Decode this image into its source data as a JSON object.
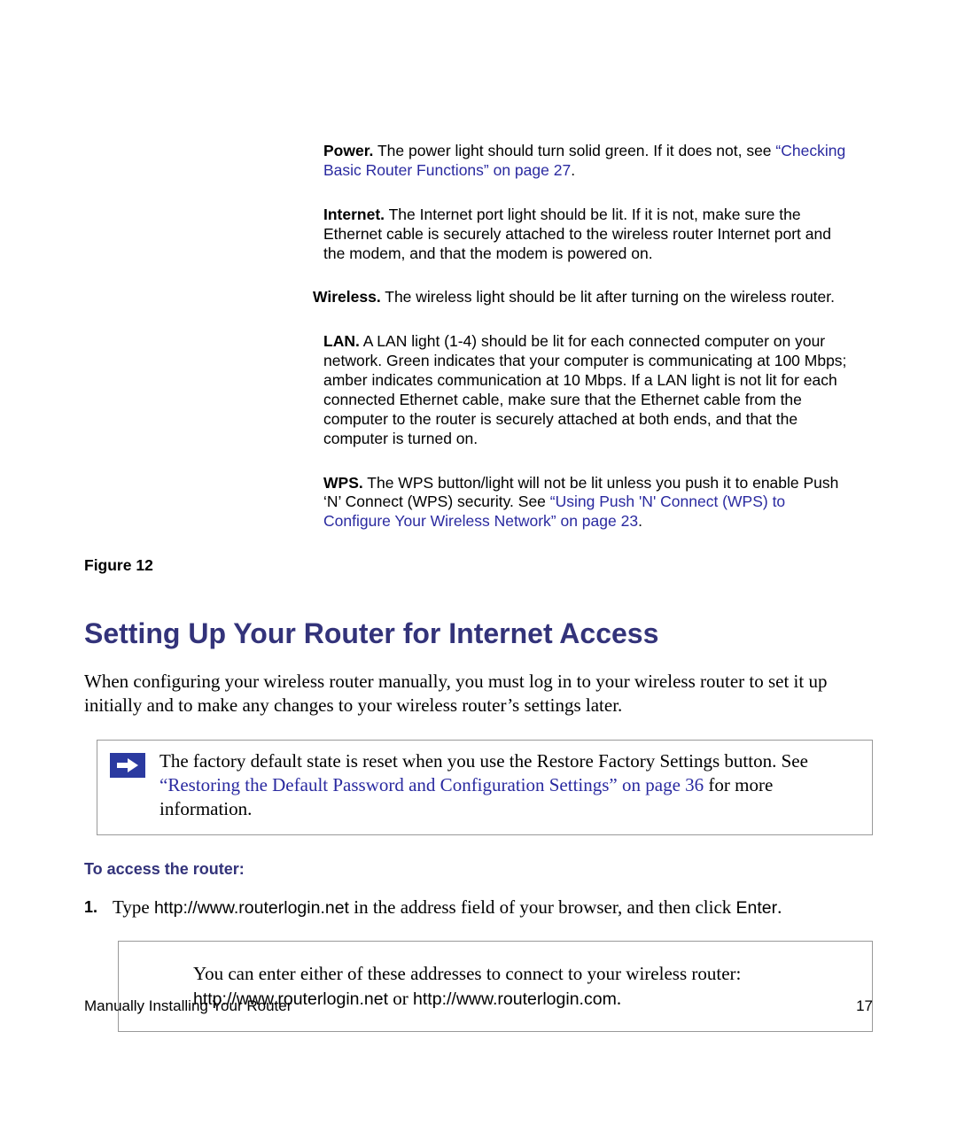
{
  "leds": {
    "power_label": "Power.",
    "power_text": " The power light should turn solid green. If it does not, see ",
    "power_link": "“Checking Basic Router Functions” on page 27",
    "power_tail": ".",
    "internet_label": "Internet.",
    "internet_text": " The Internet port light should be lit. If it is not, make sure the Ethernet cable is securely attached to the wireless router Internet port and the modem, and that the modem is powered on.",
    "wireless_label": "Wireless.",
    "wireless_text": " The wireless light should be lit after turning on the wireless router.",
    "lan_label": "LAN.",
    "lan_text": " A LAN light (1-4) should be lit for each connected computer on your network. Green indicates that your computer is communicating at 100 Mbps; amber indicates communication at 10 Mbps. If a LAN light is not lit for each connected Ethernet cable, make sure that the Ethernet cable from the computer to the router is securely attached at both ends, and that the computer is turned on.",
    "wps_label": "WPS.",
    "wps_text": " The WPS button/light will not be lit unless you push it to enable Push ‘N’ Connect (WPS) security. See ",
    "wps_link": "“Using Push 'N' Connect (WPS) to Configure Your Wireless Network” on page 23",
    "wps_tail": "."
  },
  "figure_label": "Figure 12",
  "heading": "Setting Up Your Router for Internet Access",
  "intro_para": "When configuring your wireless router manually, you must log in to your wireless router to set it up initially and to make any changes to your wireless router’s settings later.",
  "note": {
    "pre": "The factory default state is reset when you use the Restore Factory Settings button. See ",
    "link": "“Restoring the Default Password and Configuration Settings” on page 36",
    "tail": " for more information."
  },
  "access_heading": "To access the router:",
  "step1": {
    "num": "1.",
    "pre": "Type ",
    "url": "http://www.routerlogin.net",
    "mid": " in the address field of your browser, and then click ",
    "enter": "Enter",
    "tail": "."
  },
  "tip": {
    "line1": "You can enter either of these addresses to connect to your wireless router:",
    "url1": "http://www.routerlogin.net",
    "or": " or ",
    "url2": "http://www.routerlogin.com",
    "tail": "."
  },
  "footer_left": "Manually Installing Your Router",
  "footer_right": "17"
}
